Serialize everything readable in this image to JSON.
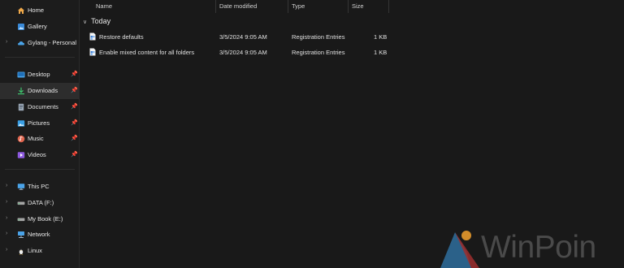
{
  "sidebar": {
    "top": [
      {
        "label": "Home",
        "icon": "home-icon"
      },
      {
        "label": "Gallery",
        "icon": "gallery-icon"
      },
      {
        "label": "Gylang - Personal",
        "icon": "onedrive-cloud-icon"
      }
    ],
    "quick_access": [
      {
        "label": "Desktop",
        "icon": "desktop-icon"
      },
      {
        "label": "Downloads",
        "icon": "downloads-icon"
      },
      {
        "label": "Documents",
        "icon": "documents-icon"
      },
      {
        "label": "Pictures",
        "icon": "pictures-icon"
      },
      {
        "label": "Music",
        "icon": "music-icon"
      },
      {
        "label": "Videos",
        "icon": "videos-icon"
      }
    ],
    "drives": [
      {
        "label": "This PC",
        "icon": "this-pc-icon"
      },
      {
        "label": "DATA (F:)",
        "icon": "drive-icon"
      },
      {
        "label": "My Book (E:)",
        "icon": "drive-icon"
      },
      {
        "label": "Network",
        "icon": "network-icon"
      },
      {
        "label": "Linux",
        "icon": "linux-penguin-icon"
      }
    ],
    "active": "Downloads"
  },
  "columns": {
    "name": "Name",
    "date_modified": "Date modified",
    "type": "Type",
    "size": "Size"
  },
  "group": {
    "label": "Today"
  },
  "files": [
    {
      "name": "Restore defaults",
      "date": "3/5/2024 9:05 AM",
      "type": "Registration Entries",
      "size": "1 KB"
    },
    {
      "name": "Enable mixed content for all folders",
      "date": "3/5/2024 9:05 AM",
      "type": "Registration Entries",
      "size": "1 KB"
    }
  ],
  "watermark": {
    "text": "WinPoin"
  },
  "colors": {
    "background": "#191919",
    "sidebar": "#1c1c1c",
    "active_item": "#2d2d2d",
    "accent_blue": "#4aa3e8"
  }
}
